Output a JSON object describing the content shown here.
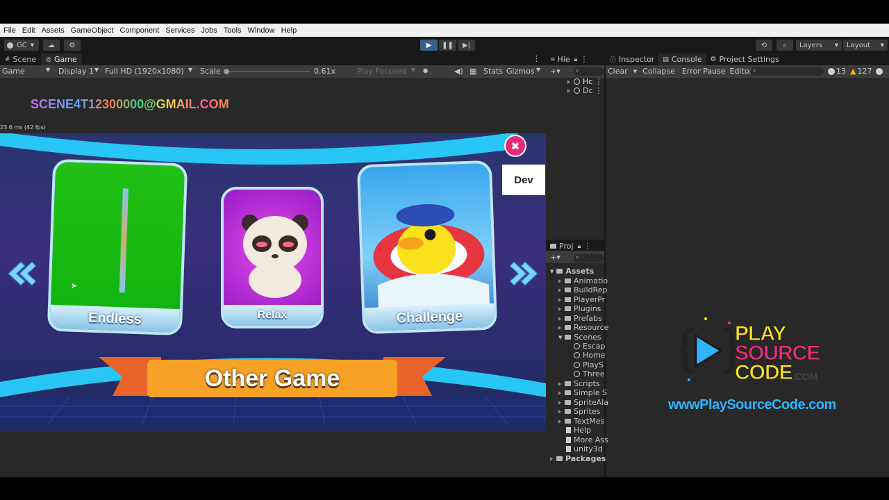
{
  "menu": [
    "File",
    "Edit",
    "Assets",
    "GameObject",
    "Component",
    "Services",
    "Jobs",
    "Tools",
    "Window",
    "Help"
  ],
  "toolbar": {
    "account": "GC",
    "layers": "Layers",
    "layout": "Layout"
  },
  "scene_tabs": {
    "scene": "Scene",
    "game": "Game"
  },
  "game_controls": {
    "mode": "Game",
    "display": "Display 1",
    "resolution": "Full HD (1920x1080)",
    "scale_label": "Scale",
    "scale_value": "0.61x",
    "play_focused": "Play Focused",
    "stats": "Stats",
    "gizmos": "Gizmos"
  },
  "game": {
    "email": "SCENE4T12300000@GMAIL.COM",
    "fps": "23.6 ms (42 fps)",
    "cards": [
      "Endless",
      "Relax",
      "Challenge"
    ],
    "dev_button": "Dev",
    "banner": "Other Game"
  },
  "hierarchy": {
    "tab": "Hie",
    "items": [
      "Hc",
      "Dc"
    ]
  },
  "inspector_tabs": [
    "Inspector",
    "Console",
    "Project Settings"
  ],
  "console": {
    "clear": "Clear",
    "collapse": "Collapse",
    "error_pause": "Error Pause",
    "editor": "Editor",
    "warn_count": "13",
    "error_count": "127"
  },
  "project": {
    "tab": "Proj",
    "root": "Assets",
    "folders": [
      "Animatio",
      "BuildRep",
      "PlayerPr",
      "Plugins",
      "Prefabs",
      "Resource",
      "Scenes"
    ],
    "scenes": [
      "Escap",
      "Home",
      "PlayS",
      "Three"
    ],
    "folders2": [
      "Scripts",
      "Simple S",
      "SpriteAla",
      "Sprites",
      "TextMes"
    ],
    "files": [
      "Help",
      "More Ass",
      "unity3d"
    ],
    "packages": "Packages"
  },
  "watermark": {
    "line1": "PLAY",
    "line2": "SOURCE",
    "line3": "CODE",
    "suffix": ".COM",
    "url": "wwwPlaySourceCode.com"
  },
  "colors": {
    "accent": "#3a5f8a",
    "warn": "#f4b400",
    "brand_yellow": "#f9e21b",
    "brand_pink": "#ec2f7a",
    "url_blue": "#2fb4ff"
  }
}
